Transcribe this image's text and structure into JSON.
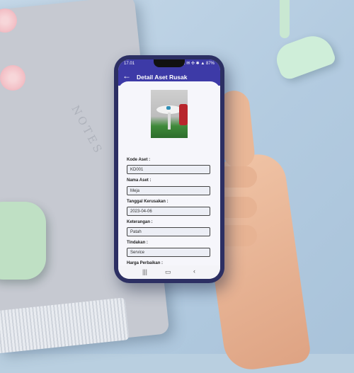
{
  "status_bar": {
    "time": "17.01",
    "icons_text": "☷ ✉ ✣   ✱ ▲ 87%"
  },
  "app_bar": {
    "title": "Detail Aset Rusak"
  },
  "fields": [
    {
      "label": "Kode Aset :",
      "value": "KD001"
    },
    {
      "label": "Nama Aset :",
      "value": "Meja"
    },
    {
      "label": "Tanggal Kerusakan :",
      "value": "2023-04-06"
    },
    {
      "label": "Keterangan :",
      "value": "Patah"
    },
    {
      "label": "Tindakan :",
      "value": "Service"
    },
    {
      "label": "Harga Perbaikan :",
      "value": ""
    }
  ],
  "background": {
    "notebook_text": "NOTES"
  },
  "icons": {
    "back": "arrow-left-icon",
    "nav_recents": "recents-icon",
    "nav_home": "home-icon",
    "nav_back": "chevron-left-icon"
  },
  "colors": {
    "app_bar": "#3d3aa7",
    "phone_body": "#2c2f63"
  }
}
